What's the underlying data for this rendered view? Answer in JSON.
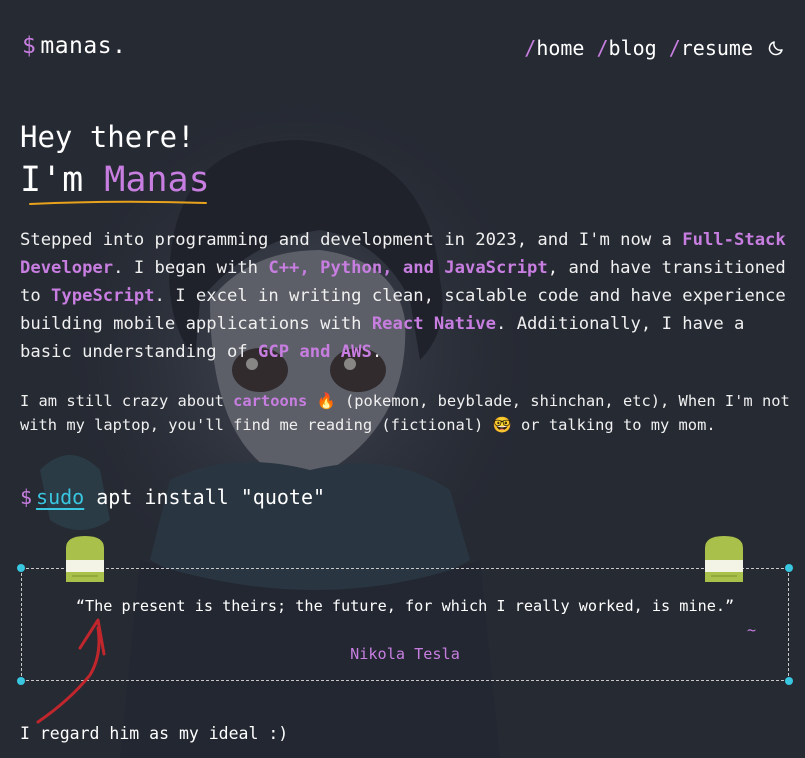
{
  "header": {
    "logo_symbol": "$",
    "logo_text": "manas.",
    "nav": [
      {
        "slash": "/",
        "label": "home"
      },
      {
        "slash": "/",
        "label": "blog"
      },
      {
        "slash": "/",
        "label": "resume"
      }
    ],
    "theme_icon": "moon-icon"
  },
  "hero": {
    "greeting": "Hey there!",
    "im": "I'm ",
    "name": "Manas"
  },
  "intro": {
    "p1": "Stepped into programming and development in 2023, and I'm now a ",
    "role": "Full-Stack Developer",
    "p2": ". I began with ",
    "langs": "C++, Python, and JavaScript",
    "p3": ", and have transitioned to ",
    "ts": "TypeScript",
    "p4": ". I excel in writing clean, scalable code and have experience building mobile applications with ",
    "rn": "React Native",
    "p5": ". Additionally, I have a basic understanding of ",
    "cloud": "GCP and AWS",
    "p6": "."
  },
  "hobbies": {
    "p1": "I am still crazy about ",
    "cartoons": "cartoons",
    "emoji1": "🔥",
    "p2": " (pokemon, beyblade, shinchan, etc), When I'm not with my laptop, you'll find me reading (fictional) ",
    "emoji2": "🤓",
    "p3": " or talking to my mom."
  },
  "command": {
    "prompt": "$",
    "sudo": "sudo",
    "rest": " apt install \"quote\""
  },
  "quote": {
    "text": "“The present is theirs; the future, for which I really worked, is mine.”",
    "tilde": "~",
    "author": "Nikola Tesla"
  },
  "footer_note": "I regard him as my ideal :)",
  "colors": {
    "background": "#262a33",
    "accent": "#c77ee0",
    "link": "#38c6e0",
    "underline": "#e8a21c",
    "tape": "#a9c14a"
  }
}
